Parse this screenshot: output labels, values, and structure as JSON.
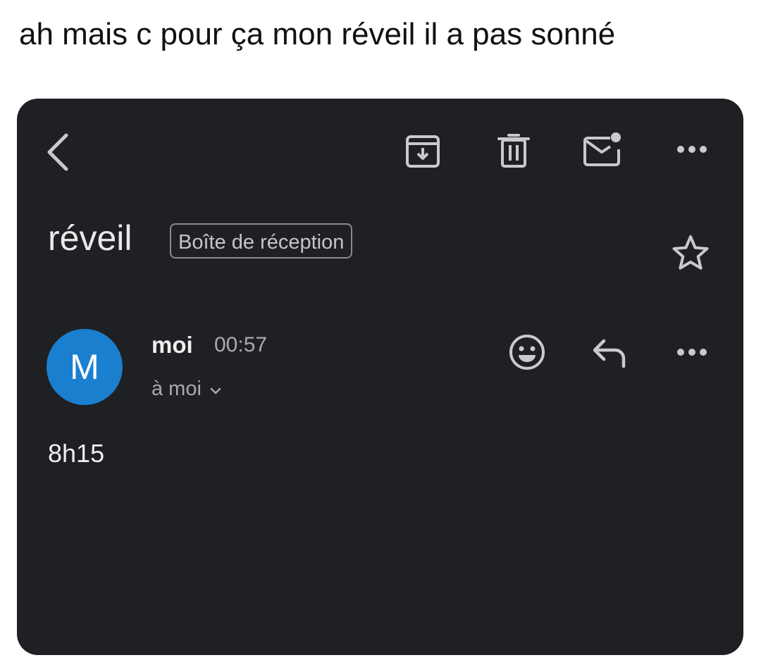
{
  "caption": "ah mais c pour ça mon réveil il a pas sonné",
  "colors": {
    "panel_background": "#1f2023",
    "avatar_background": "#1b7fd0",
    "primary_text": "#eeeeef",
    "secondary_text": "#a9aaac",
    "icon_color": "#c9cacc"
  },
  "toolbar": {
    "icons": [
      "back-arrow-icon",
      "archive-icon",
      "trash-icon",
      "mark-unread-icon",
      "more-options-icon"
    ]
  },
  "email": {
    "subject": "réveil",
    "label": "Boîte de réception",
    "star_icon": "star-outline-icon",
    "sender": {
      "avatar_initial": "M",
      "name": "moi",
      "time": "00:57",
      "recipient": "à moi",
      "recipient_icon": "chevron-down-icon"
    },
    "actions": [
      "emoji-reaction-icon",
      "reply-icon",
      "more-options-icon"
    ],
    "body": "8h15"
  }
}
